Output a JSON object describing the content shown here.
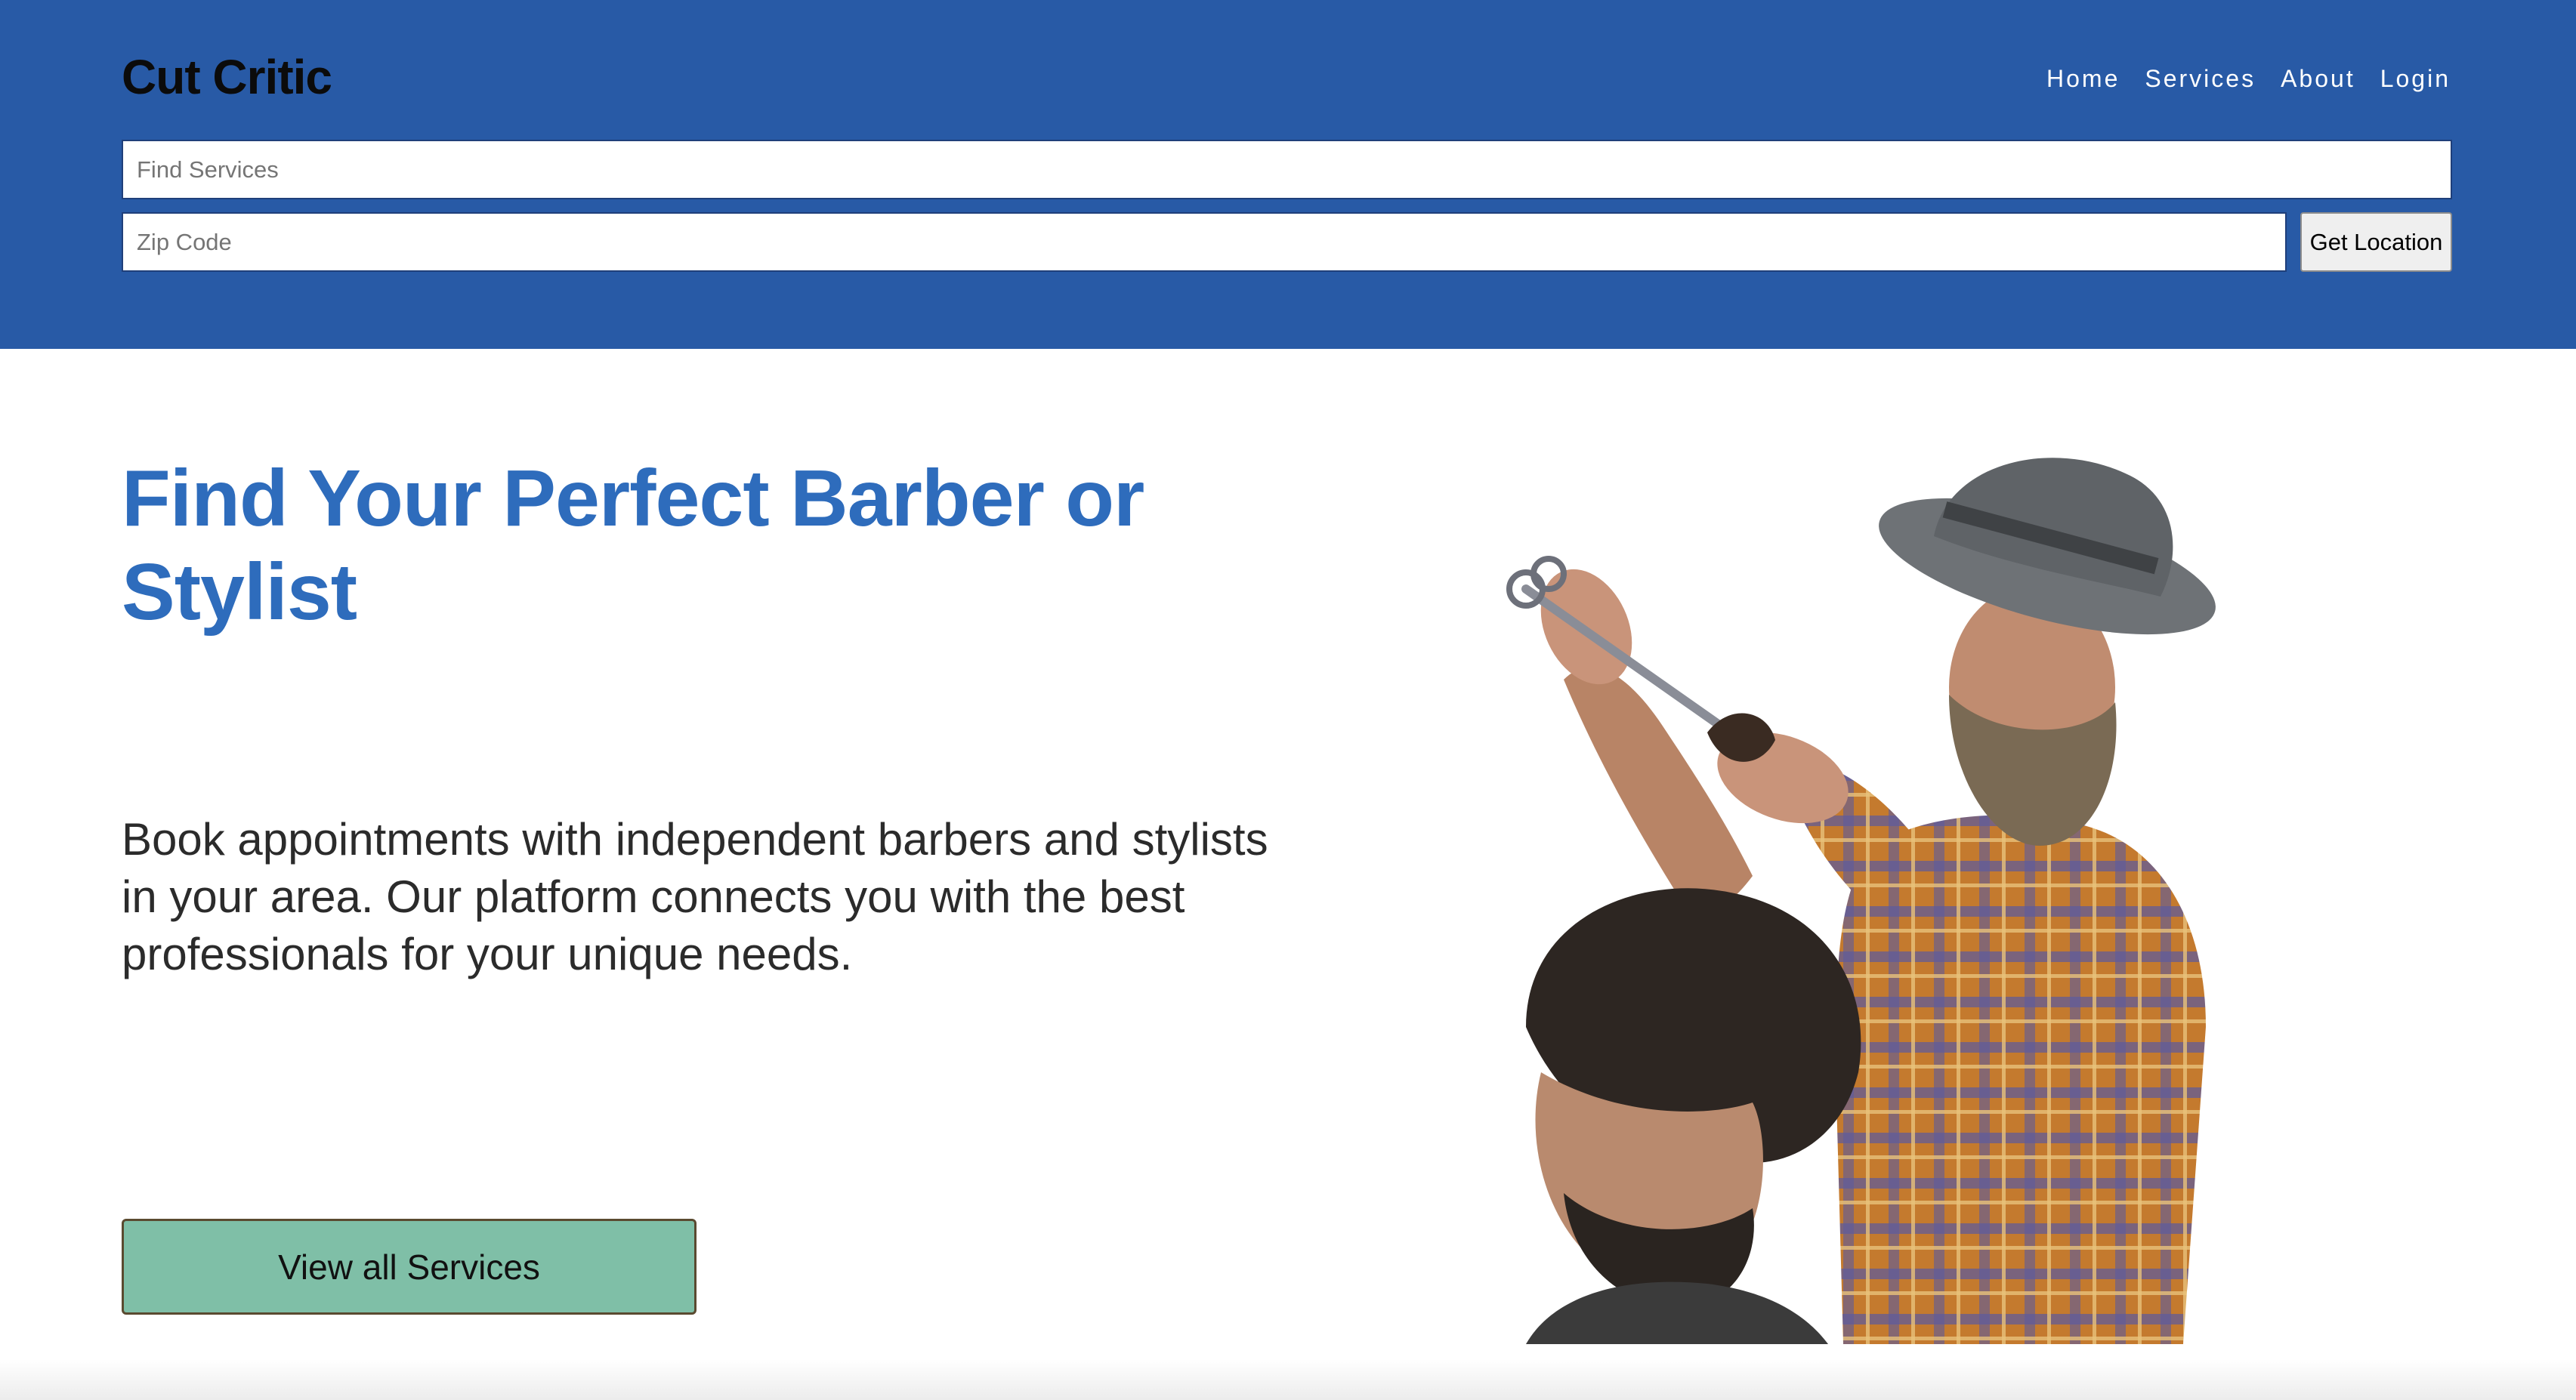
{
  "header": {
    "brand": "Cut Critic",
    "nav": [
      {
        "label": "Home"
      },
      {
        "label": "Services"
      },
      {
        "label": "About"
      },
      {
        "label": "Login"
      }
    ],
    "search": {
      "placeholder": "Find Services",
      "value": ""
    },
    "zip": {
      "placeholder": "Zip Code",
      "value": ""
    },
    "location_button": "Get Location",
    "background_color": "#285aa6"
  },
  "hero": {
    "title": "Find Your Perfect Barber or Stylist",
    "description": "Book appointments with independent barbers and stylists in your area. Our platform connects you with the best professionals for your unique needs.",
    "cta_label": "View all Services",
    "cta_color": "#7fbfa7",
    "title_color": "#2e6cbc",
    "image": "barber-cutting-hair-illustration"
  }
}
